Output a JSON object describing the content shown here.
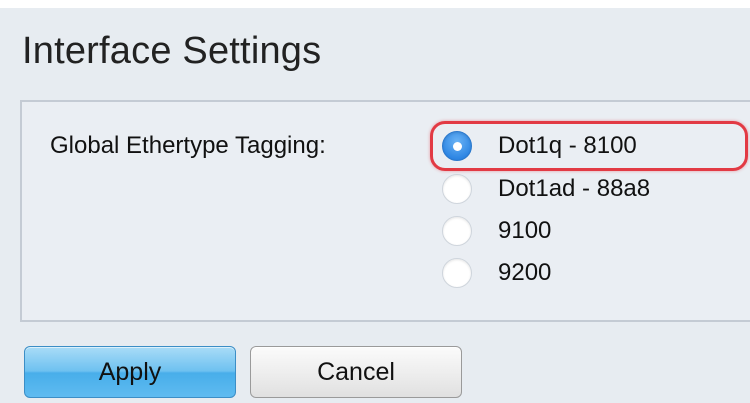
{
  "page": {
    "title": "Interface Settings"
  },
  "form": {
    "field_label": "Global Ethertype Tagging:",
    "selected_value": "Dot1q - 8100",
    "options": [
      {
        "label": "Dot1q - 8100",
        "checked": true
      },
      {
        "label": "Dot1ad - 88a8",
        "checked": false
      },
      {
        "label": "9100",
        "checked": false
      },
      {
        "label": "9200",
        "checked": false
      }
    ]
  },
  "buttons": {
    "apply_label": "Apply",
    "cancel_label": "Cancel"
  },
  "colors": {
    "panel_background": "#e7ecf1",
    "radio_selected": "#2f87e4",
    "highlight_annotation": "#e23a44",
    "apply_button": "#6ec1f0"
  }
}
